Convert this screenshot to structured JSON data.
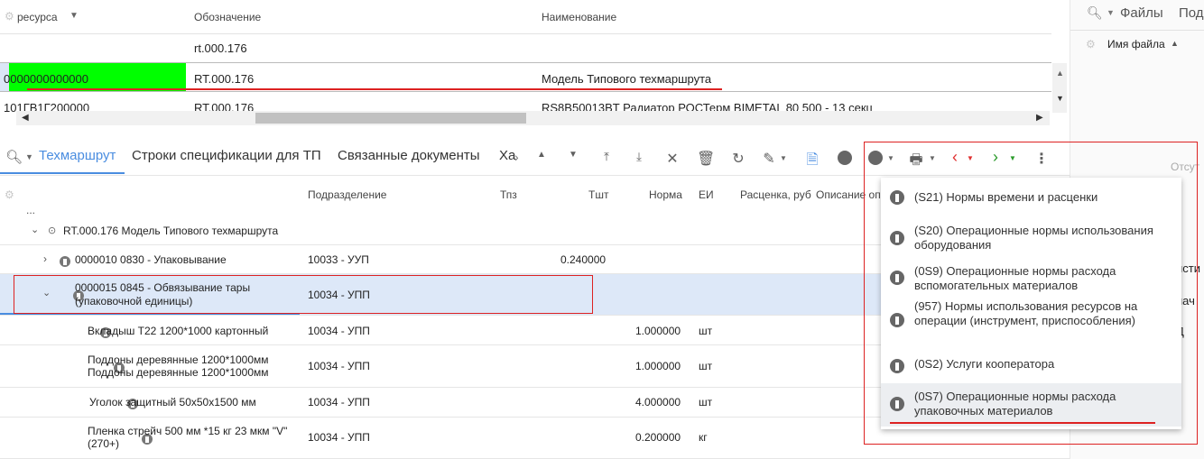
{
  "top_grid": {
    "headers": {
      "resource": "ресурса",
      "designation": "Обозначение",
      "name": "Наименование"
    },
    "filter_value": "rt.000.176",
    "rows": [
      {
        "code": "0000000000000",
        "designation": "RT.000.176",
        "name": "Модель Типового техмаршрута"
      },
      {
        "code": "101ГВ1Г200000",
        "designation": "RT.000.176",
        "name": "RS8B50013BT Радиатор РОСТерм BIMETAL 80 500 - 13 секц"
      }
    ]
  },
  "right_pane": {
    "files_tab": "Файлы",
    "second_tab": "Под",
    "file_name_header": "Имя файла",
    "absent": "Отсут",
    "frag1": "исти",
    "frag2": "нач",
    "frag3": "Д"
  },
  "tabs": [
    "Техмаршрут",
    "Строки спецификации для ТП",
    "Связанные документы",
    "Ха"
  ],
  "grid": {
    "headers": {
      "division": "Подразделение",
      "tpz": "Тпз",
      "tsht": "Тшт",
      "norm": "Норма",
      "ei": "ЕИ",
      "rate": "Расценка, руб",
      "desc": "Описание опе"
    },
    "ellipsis": "...",
    "rows": [
      {
        "name": "RT.000.176 Модель Типового техмаршрута",
        "division": "",
        "tsht": "",
        "norm": "",
        "ei": ""
      },
      {
        "name": "0000010  0830 - Упаковывание",
        "division": "10033 - УУП",
        "tsht": "0.240000",
        "norm": "",
        "ei": ""
      },
      {
        "name": "0000015  0845 - Обвязывание тары (упаковочной единицы)",
        "division": "10034 - УПП",
        "tsht": "",
        "norm": "",
        "ei": ""
      },
      {
        "name": "Вкладыш Т22 1200*1000 картонный",
        "division": "10034 - УПП",
        "tsht": "",
        "norm": "1.000000",
        "ei": "шт"
      },
      {
        "name": "Поддоны деревянные 1200*1000мм Поддоны деревянные 1200*1000мм",
        "division": "10034 - УПП",
        "tsht": "",
        "norm": "1.000000",
        "ei": "шт"
      },
      {
        "name": "Уголок защитный 50х50х1500 мм",
        "division": "10034 - УПП",
        "tsht": "",
        "norm": "4.000000",
        "ei": "шт"
      },
      {
        "name": "Пленка стрейч 500 мм *15 кг 23 мкм \"V\" (270+)",
        "division": "10034 - УПП",
        "tsht": "",
        "norm": "0.200000",
        "ei": "кг"
      }
    ]
  },
  "menu": [
    "(S21) Нормы времени и расценки",
    "(S20) Операционные нормы использования оборудования",
    "(0S9) Операционные нормы расхода вспомогательных материалов",
    "(957) Нормы использования ресурсов на операции (инструмент, приспособления)",
    "(0S2) Услуги кооператора",
    "(0S7) Операционные нормы расхода упаковочных материалов"
  ],
  "colors": {
    "accent": "#4a8de0",
    "highlight_green": "#00ff00",
    "annotation_red": "#dd2222",
    "selected_row": "#dde8f8"
  }
}
